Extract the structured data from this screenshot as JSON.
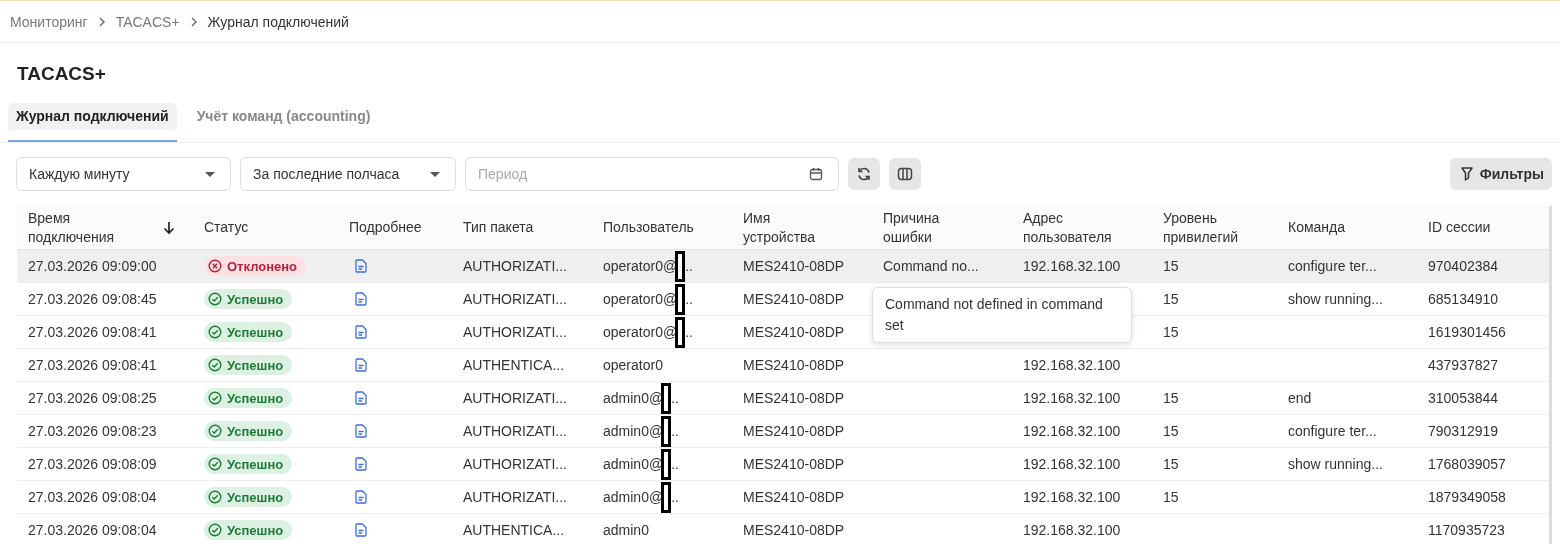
{
  "breadcrumbs": [
    {
      "label": "Мониторинг",
      "current": false
    },
    {
      "label": "TACACS+",
      "current": false
    },
    {
      "label": "Журнал подключений",
      "current": true
    }
  ],
  "page_title": "TACACS+",
  "tabs": [
    {
      "label": "Журнал подключений",
      "selected": true
    },
    {
      "label": "Учёт команд (accounting)",
      "selected": false
    }
  ],
  "toolbar": {
    "refresh_interval": "Каждую минуту",
    "time_range": "За последние полчаса",
    "period": {
      "placeholder": "Период"
    },
    "filters_button": "Фильтры"
  },
  "table": {
    "columns": [
      {
        "label": "Время подключения",
        "sorted_descending": true
      },
      {
        "label": "Статус"
      },
      {
        "label": "Подробнее"
      },
      {
        "label": "Тип пакета"
      },
      {
        "label": "Пользователь"
      },
      {
        "label": "Имя устройства"
      },
      {
        "label": "Причина ошибки"
      },
      {
        "label": "Адрес пользователя"
      },
      {
        "label": "Уровень привилегий"
      },
      {
        "label": "Команда"
      },
      {
        "label": "ID сессии"
      }
    ],
    "rows": [
      {
        "time": "27.03.2026 09:09:00",
        "status": {
          "kind": "rejected",
          "label": "Отклонено"
        },
        "packet_type": "AUTHORIZATI...",
        "user": "operator0@",
        "redacted": true,
        "user_tail": "..",
        "device": "MES2410-08DP",
        "error": "Command no...",
        "error_tooltip": "Command not defined in command set",
        "address": "192.168.32.100",
        "privilege": "15",
        "command": "configure ter...",
        "session_id": "970402384",
        "hovered": true
      },
      {
        "time": "27.03.2026 09:08:45",
        "status": {
          "kind": "success",
          "label": "Успешно"
        },
        "packet_type": "AUTHORIZATI...",
        "user": "operator0@",
        "redacted": true,
        "user_tail": "..",
        "device": "MES2410-08DP",
        "privilege": "15",
        "command": "show running...",
        "session_id": "685134910",
        "hovered": false
      },
      {
        "time": "27.03.2026 09:08:41",
        "status": {
          "kind": "success",
          "label": "Успешно"
        },
        "packet_type": "AUTHORIZATI...",
        "user": "operator0@",
        "redacted": true,
        "user_tail": "..",
        "device": "MES2410-08DP",
        "privilege": "15",
        "session_id": "1619301456",
        "hovered": false
      },
      {
        "time": "27.03.2026 09:08:41",
        "status": {
          "kind": "success",
          "label": "Успешно"
        },
        "packet_type": "AUTHENTICA...",
        "user": "operator0",
        "redacted": false,
        "device": "MES2410-08DP",
        "address": "192.168.32.100",
        "session_id": "437937827",
        "hovered": false
      },
      {
        "time": "27.03.2026 09:08:25",
        "status": {
          "kind": "success",
          "label": "Успешно"
        },
        "packet_type": "AUTHORIZATI...",
        "user": "admin0@",
        "redacted": true,
        "user_tail": "..",
        "device": "MES2410-08DP",
        "address": "192.168.32.100",
        "privilege": "15",
        "command": "end",
        "session_id": "310053844",
        "hovered": false
      },
      {
        "time": "27.03.2026 09:08:23",
        "status": {
          "kind": "success",
          "label": "Успешно"
        },
        "packet_type": "AUTHORIZATI...",
        "user": "admin0@",
        "redacted": true,
        "user_tail": "..",
        "device": "MES2410-08DP",
        "address": "192.168.32.100",
        "privilege": "15",
        "command": "configure ter...",
        "session_id": "790312919",
        "hovered": false
      },
      {
        "time": "27.03.2026 09:08:09",
        "status": {
          "kind": "success",
          "label": "Успешно"
        },
        "packet_type": "AUTHORIZATI...",
        "user": "admin0@",
        "redacted": true,
        "user_tail": "..",
        "device": "MES2410-08DP",
        "address": "192.168.32.100",
        "privilege": "15",
        "command": "show running...",
        "session_id": "1768039057",
        "hovered": false
      },
      {
        "time": "27.03.2026 09:08:04",
        "status": {
          "kind": "success",
          "label": "Успешно"
        },
        "packet_type": "AUTHORIZATI...",
        "user": "admin0@",
        "redacted": true,
        "user_tail": "..",
        "device": "MES2410-08DP",
        "address": "192.168.32.100",
        "privilege": "15",
        "session_id": "1879349058",
        "hovered": false
      },
      {
        "time": "27.03.2026 09:08:04",
        "status": {
          "kind": "success",
          "label": "Успешно"
        },
        "packet_type": "AUTHENTICA...",
        "user": "admin0",
        "redacted": false,
        "device": "MES2410-08DP",
        "address": "192.168.32.100",
        "session_id": "1170935723",
        "hovered": false
      }
    ]
  }
}
